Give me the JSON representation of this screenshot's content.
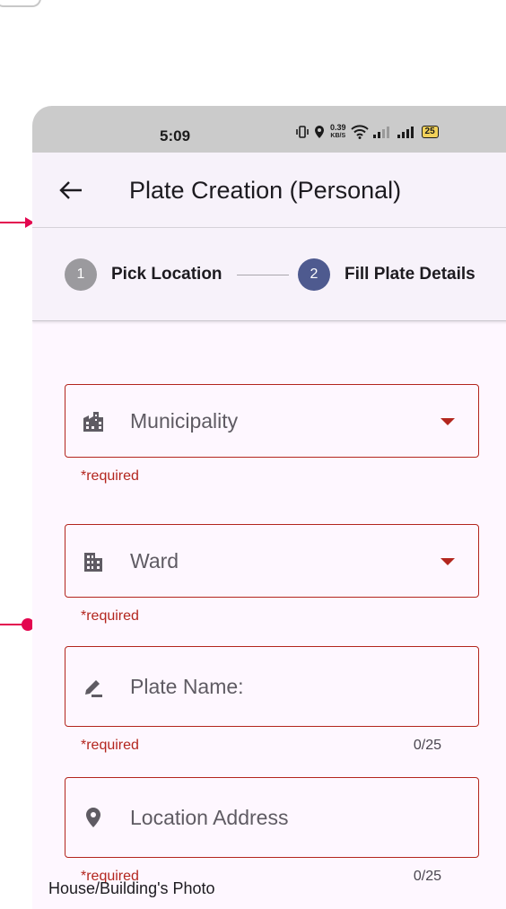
{
  "status_bar": {
    "time": "5:09",
    "net_speed_value": "0.39",
    "net_speed_unit": "KB/S",
    "battery": "25"
  },
  "app_bar": {
    "title": "Plate Creation (Personal)"
  },
  "stepper": {
    "steps": [
      {
        "number": "1",
        "label": "Pick Location",
        "state": "inactive"
      },
      {
        "number": "2",
        "label": "Fill Plate Details",
        "state": "active"
      }
    ]
  },
  "form": {
    "municipality": {
      "label": "Municipality",
      "helper": "*required",
      "icon": "city-icon"
    },
    "ward": {
      "label": "Ward",
      "helper": "*required",
      "icon": "building-icon"
    },
    "plate_name": {
      "label": "Plate Name:",
      "helper": "*required",
      "counter": "0/25",
      "icon": "edit-icon"
    },
    "location_address": {
      "label": "Location Address",
      "helper": "*required",
      "counter": "0/25",
      "icon": "location-pin-icon"
    },
    "photo_section_label": "House/Building's Photo"
  },
  "colors": {
    "error": "#b3261e",
    "step_active": "#4e5a8f",
    "step_inactive": "#9b9a9e",
    "annotation": "#e3064f"
  }
}
